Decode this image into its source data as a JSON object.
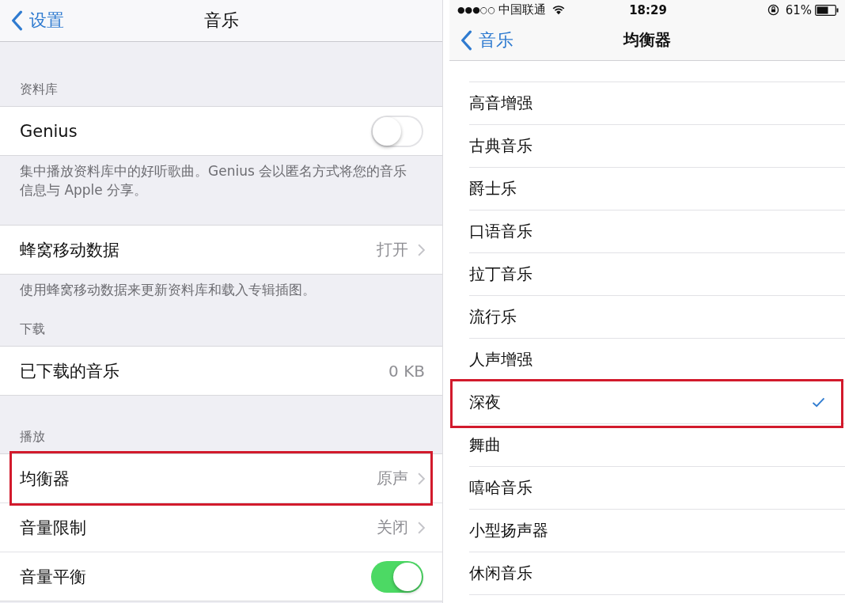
{
  "left": {
    "nav": {
      "back": "设置",
      "title": "音乐"
    },
    "sections": [
      {
        "header": "资料库",
        "rows": [
          {
            "kind": "switch",
            "label": "Genius",
            "on": false,
            "highlighted": false
          }
        ],
        "footer": "集中播放资料库中的好听歌曲。Genius 会以匿名方式将您的音乐信息与 Apple 分享。"
      },
      {
        "rows": [
          {
            "kind": "link",
            "label": "蜂窝移动数据",
            "value": "打开",
            "highlighted": false
          }
        ],
        "footer": "使用蜂窝移动数据来更新资料库和载入专辑插图。"
      },
      {
        "header": "下载",
        "rows": [
          {
            "kind": "value",
            "label": "已下载的音乐",
            "value": "0 KB",
            "highlighted": false
          }
        ]
      },
      {
        "header": "播放",
        "rows": [
          {
            "kind": "link",
            "label": "均衡器",
            "value": "原声",
            "highlighted": true
          },
          {
            "kind": "link",
            "label": "音量限制",
            "value": "关闭",
            "highlighted": false
          },
          {
            "kind": "switch",
            "label": "音量平衡",
            "on": true,
            "highlighted": false
          }
        ]
      }
    ]
  },
  "right": {
    "status_bar": {
      "signal": "●●●○○",
      "carrier": "中国联通",
      "time": "18:29",
      "battery": "61%"
    },
    "nav": {
      "back": "音乐",
      "title": "均衡器"
    },
    "options": [
      {
        "label": "高音增强",
        "selected": false,
        "highlighted": false
      },
      {
        "label": "古典音乐",
        "selected": false,
        "highlighted": false
      },
      {
        "label": "爵士乐",
        "selected": false,
        "highlighted": false
      },
      {
        "label": "口语音乐",
        "selected": false,
        "highlighted": false
      },
      {
        "label": "拉丁音乐",
        "selected": false,
        "highlighted": false
      },
      {
        "label": "流行乐",
        "selected": false,
        "highlighted": false
      },
      {
        "label": "人声增强",
        "selected": false,
        "highlighted": false
      },
      {
        "label": "深夜",
        "selected": true,
        "highlighted": true
      },
      {
        "label": "舞曲",
        "selected": false,
        "highlighted": false
      },
      {
        "label": "嘻哈音乐",
        "selected": false,
        "highlighted": false
      },
      {
        "label": "小型扬声器",
        "selected": false,
        "highlighted": false
      },
      {
        "label": "休闲音乐",
        "selected": false,
        "highlighted": false
      }
    ]
  }
}
